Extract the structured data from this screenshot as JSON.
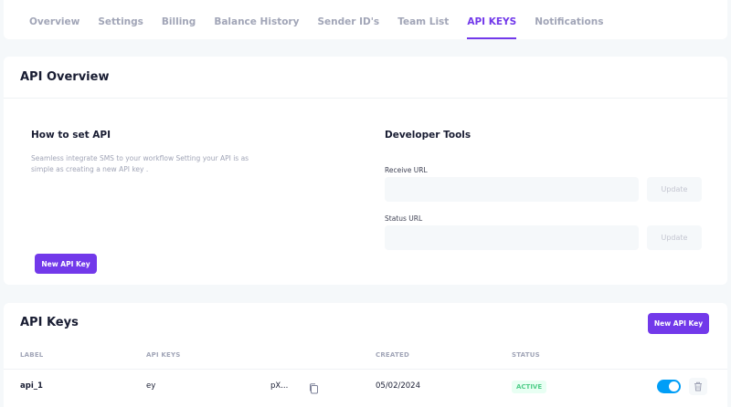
{
  "nav": {
    "tabs": [
      {
        "label": "Overview",
        "active": false
      },
      {
        "label": "Settings",
        "active": false
      },
      {
        "label": "Billing",
        "active": false
      },
      {
        "label": "Balance History",
        "active": false
      },
      {
        "label": "Sender ID's",
        "active": false
      },
      {
        "label": "Team List",
        "active": false
      },
      {
        "label": "API KEYS",
        "active": true
      },
      {
        "label": "Notifications",
        "active": false
      }
    ]
  },
  "overview": {
    "title": "API Overview",
    "how_to": {
      "title": "How to set API",
      "description": "Seamless integrate SMS to your workflow Setting your API is as simple as creating a new API key .",
      "button_label": "New API Key"
    },
    "developer_tools": {
      "title": "Developer Tools",
      "receive_url": {
        "label": "Receive URL",
        "value": "",
        "button_label": "Update"
      },
      "status_url": {
        "label": "Status URL",
        "value": "",
        "button_label": "Update"
      }
    }
  },
  "api_keys": {
    "title": "API Keys",
    "new_button_label": "New API Key",
    "columns": [
      "LABEL",
      "API KEYS",
      "CREATED",
      "STATUS"
    ],
    "rows": [
      {
        "label": "api_1",
        "key_start": "ey",
        "key_end": "pX...",
        "created": "05/02/2024",
        "status": "ACTIVE",
        "enabled": true
      }
    ]
  },
  "colors": {
    "accent": "#7239ea",
    "toggle_on": "#009ef7",
    "success": "#50cd89",
    "muted": "#a1a5b7"
  },
  "icons": [
    "copy-icon",
    "trash-icon"
  ]
}
